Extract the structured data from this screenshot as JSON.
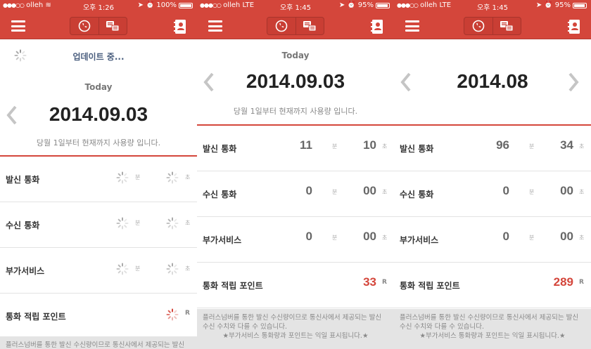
{
  "colors": {
    "accent": "#d4463b",
    "point": "#d4463b"
  },
  "screens": [
    {
      "status": {
        "carrier": "olleh",
        "network": "",
        "time": "오후 1:26",
        "battery": "100%",
        "battery_level": 1.0
      },
      "updating": "업데이트 중...",
      "today_label": "Today",
      "date": "2014.09.03",
      "desc": "당월 1일부터 현재까지 사용량 입니다.",
      "rows": [
        {
          "label": "발신 통화",
          "min": "",
          "min_unit": "분",
          "sec": "",
          "sec_unit": "초"
        },
        {
          "label": "수신 통화",
          "min": "",
          "min_unit": "분",
          "sec": "",
          "sec_unit": "초"
        },
        {
          "label": "부가서비스",
          "min": "",
          "min_unit": "분",
          "sec": "",
          "sec_unit": "초"
        }
      ],
      "points": {
        "label": "통화 적립 포인트",
        "value": "",
        "unit": "R"
      },
      "note": {
        "line1": "플러스넘버를 통한 발신 수신량이므로 통신사에서 제공되는 발신",
        "line2": "",
        "line3": ""
      }
    },
    {
      "status": {
        "carrier": "olleh",
        "network": "LTE",
        "time": "오후 1:45",
        "battery": "95%",
        "battery_level": 0.95
      },
      "today_label": "Today",
      "date": "2014.09.03",
      "desc": "당월 1일부터 현재까지 사용량 입니다.",
      "rows": [
        {
          "label": "발신 통화",
          "min": "11",
          "min_unit": "분",
          "sec": "10",
          "sec_unit": "초"
        },
        {
          "label": "수신 통화",
          "min": "0",
          "min_unit": "분",
          "sec": "00",
          "sec_unit": "초"
        },
        {
          "label": "부가서비스",
          "min": "0",
          "min_unit": "분",
          "sec": "00",
          "sec_unit": "초"
        }
      ],
      "points": {
        "label": "통화 적립 포인트",
        "value": "33",
        "unit": "R"
      },
      "note": {
        "line1": "플러스넘버를 통한 발신 수신량이므로 통신사에서 제공되는 발신",
        "line2": "수신 수치와 다를 수 있습니다.",
        "line3": "★부가서비스 통화량과 포인트는 익일 표시됩니다.★"
      }
    },
    {
      "status": {
        "carrier": "olleh",
        "network": "LTE",
        "time": "오후 1:45",
        "battery": "95%",
        "battery_level": 0.95
      },
      "today_label": "",
      "date": "2014.08",
      "desc": "",
      "rows": [
        {
          "label": "발신 통화",
          "min": "96",
          "min_unit": "분",
          "sec": "34",
          "sec_unit": "초"
        },
        {
          "label": "수신 통화",
          "min": "0",
          "min_unit": "분",
          "sec": "00",
          "sec_unit": "초"
        },
        {
          "label": "부가서비스",
          "min": "0",
          "min_unit": "분",
          "sec": "00",
          "sec_unit": "초"
        }
      ],
      "points": {
        "label": "통화 적립 포인트",
        "value": "289",
        "unit": "R"
      },
      "note": {
        "line1": "플러스넘버를 통한 발신 수신량이므로 통신사에서 제공되는 발신",
        "line2": "수신 수치와 다를 수 있습니다.",
        "line3": "★부가서비스 통화량과 포인트는 익일 표시됩니다.★"
      }
    }
  ]
}
